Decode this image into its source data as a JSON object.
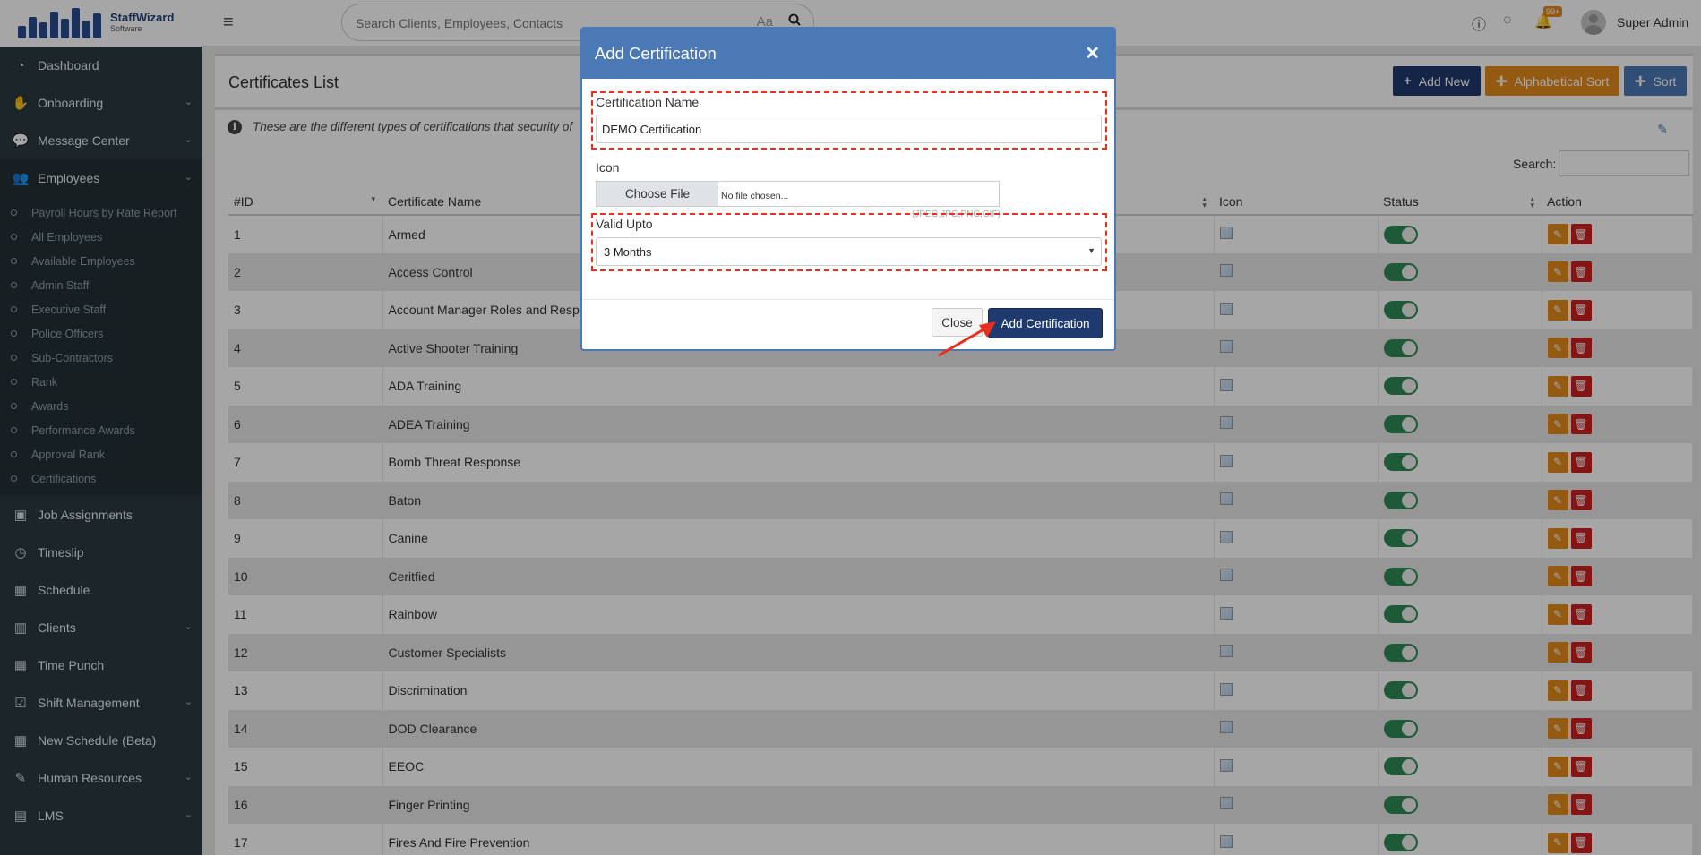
{
  "logo": {
    "brand": "StaffWizard",
    "sub": "Software"
  },
  "sidebar": {
    "items": [
      {
        "label": "Dashboard",
        "icon": "dashboard-icon"
      },
      {
        "label": "Onboarding",
        "icon": "handshake-icon"
      },
      {
        "label": "Message Center",
        "icon": "comments-icon"
      },
      {
        "label": "Employees",
        "icon": "users-icon"
      },
      {
        "label": "Job Assignments",
        "icon": "briefcase-icon"
      },
      {
        "label": "Timeslip",
        "icon": "clock-icon"
      },
      {
        "label": "Schedule",
        "icon": "calendar-icon"
      },
      {
        "label": "Clients",
        "icon": "building-icon"
      },
      {
        "label": "Time Punch",
        "icon": "calendar-icon"
      },
      {
        "label": "Shift Management",
        "icon": "calendar-check-icon"
      },
      {
        "label": "New Schedule (Beta)",
        "icon": "calendar-icon"
      },
      {
        "label": "Human Resources",
        "icon": "pencil-icon"
      },
      {
        "label": "LMS",
        "icon": "books-icon"
      }
    ],
    "employees_sub": [
      "Payroll Hours by Rate Report",
      "All Employees",
      "Available Employees",
      "Admin Staff",
      "Executive Staff",
      "Police Officers",
      "Sub-Contractors",
      "Rank",
      "Awards",
      "Performance Awards",
      "Approval Rank",
      "Certifications"
    ]
  },
  "header": {
    "search_placeholder": "Search Clients, Employees, Contacts",
    "aa": "Aa",
    "badge": "99+",
    "user": "Super Admin"
  },
  "page": {
    "title": "Certificates List",
    "add_new": "Add New",
    "alpha_sort": "Alphabetical Sort",
    "sort": "Sort",
    "info": "These are the different types of certifications that security of",
    "search_label": "Search:"
  },
  "colors": {
    "sidebar": "#2c3b41",
    "primary": "#1f3a6e",
    "orange": "#e38b1b",
    "blue": "#4a79b6",
    "red": "#cc1f1f",
    "green": "#2e8b57"
  },
  "table": {
    "headers": {
      "id": "#ID",
      "name": "Certificate Name",
      "icon": "Icon",
      "status": "Status",
      "action": "Action"
    },
    "rows": [
      {
        "id": "1",
        "name": "Armed"
      },
      {
        "id": "2",
        "name": "Access Control"
      },
      {
        "id": "3",
        "name": "Account Manager Roles and Respon"
      },
      {
        "id": "4",
        "name": "Active Shooter Training"
      },
      {
        "id": "5",
        "name": "ADA Training"
      },
      {
        "id": "6",
        "name": "ADEA Training"
      },
      {
        "id": "7",
        "name": "Bomb Threat Response"
      },
      {
        "id": "8",
        "name": "Baton"
      },
      {
        "id": "9",
        "name": "Canine"
      },
      {
        "id": "10",
        "name": "Ceritfied"
      },
      {
        "id": "11",
        "name": "Rainbow"
      },
      {
        "id": "12",
        "name": "Customer Specialists"
      },
      {
        "id": "13",
        "name": "Discrimination"
      },
      {
        "id": "14",
        "name": "DOD Clearance"
      },
      {
        "id": "15",
        "name": "EEOC"
      },
      {
        "id": "16",
        "name": "Finger Printing"
      },
      {
        "id": "17",
        "name": "Fires And Fire Prevention"
      }
    ]
  },
  "modal": {
    "title": "Add Certification",
    "name_label": "Certification Name",
    "name_value": "DEMO Certification",
    "icon_label": "Icon",
    "choose_file": "Choose File",
    "no_file": "No file chosen...",
    "hint": "(JPEG,JPG,PNG,GIF)",
    "valid_label": "Valid Upto",
    "valid_value": "3 Months",
    "close": "Close",
    "submit": "Add Certification"
  }
}
